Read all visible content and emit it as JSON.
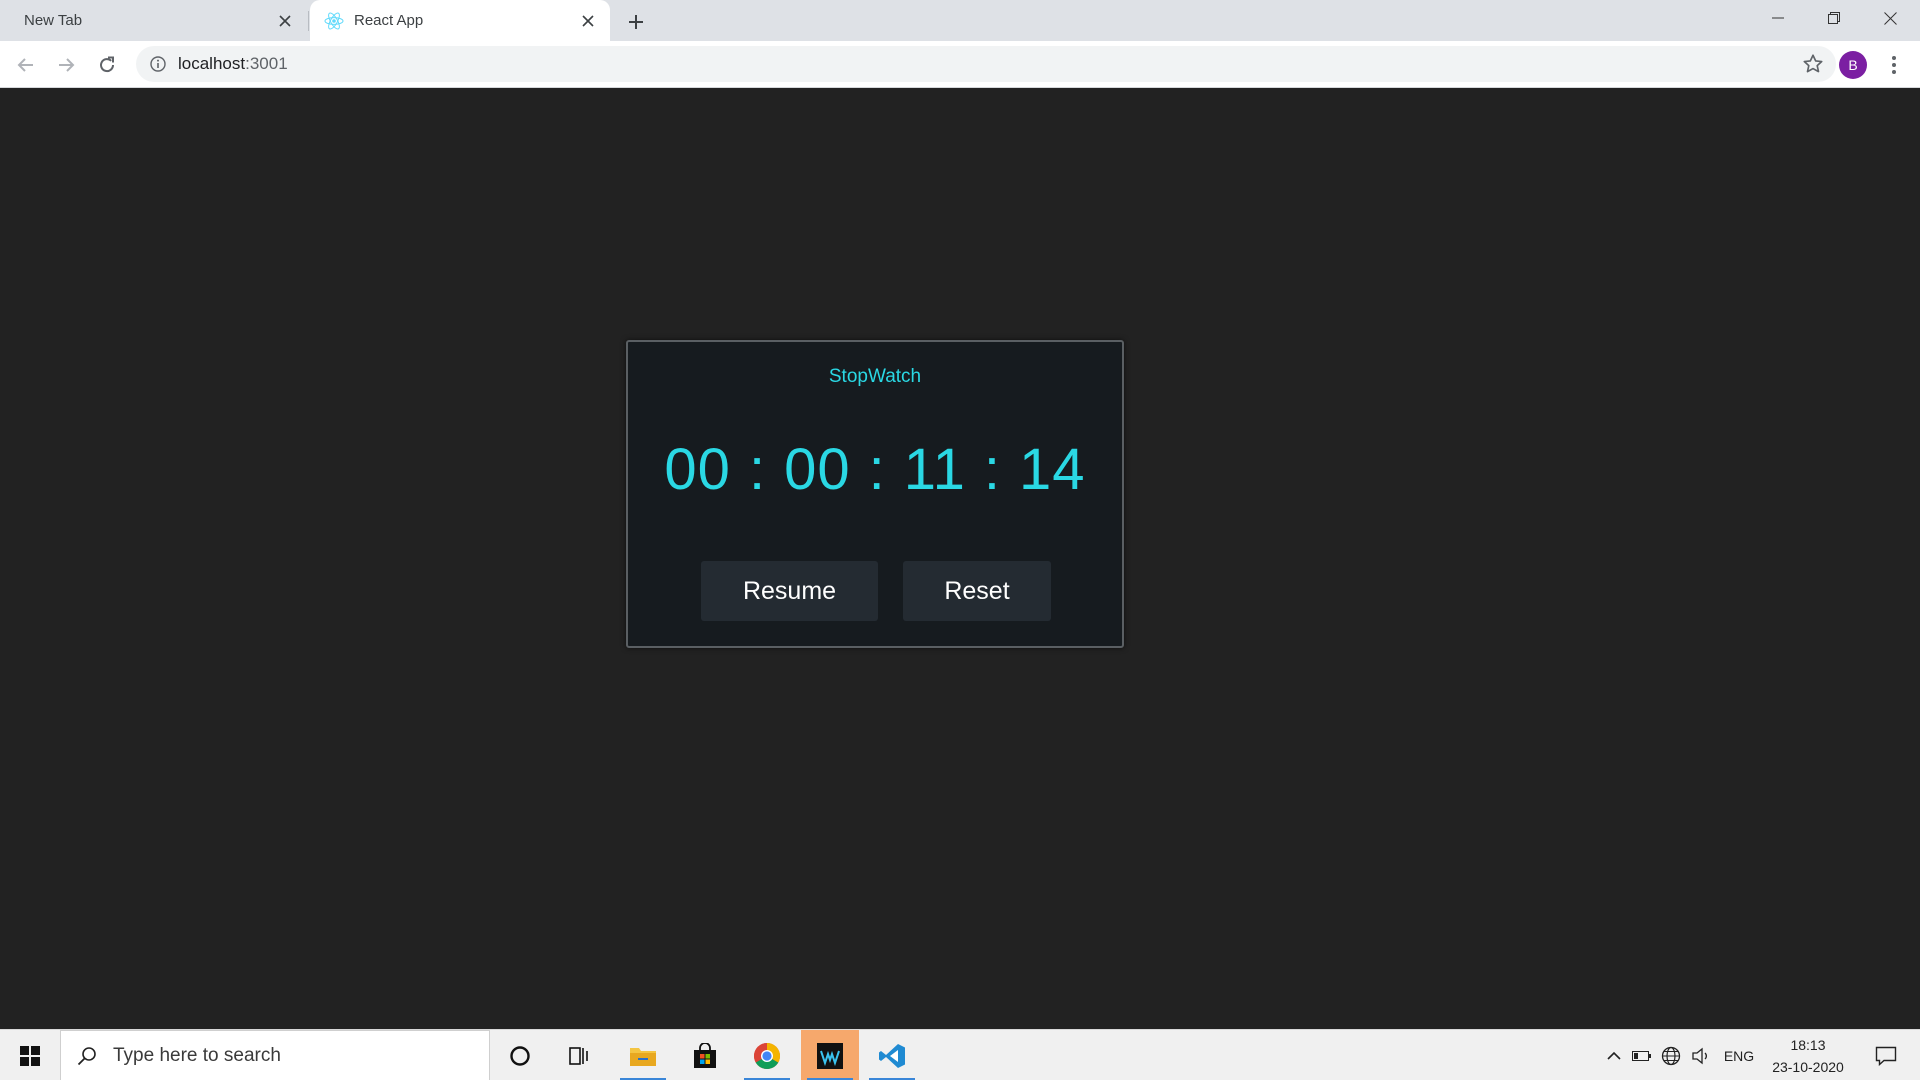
{
  "browser": {
    "tabs": [
      {
        "title": "New Tab",
        "active": false
      },
      {
        "title": "React App",
        "active": true
      }
    ],
    "url_host": "localhost",
    "url_port": ":3001",
    "profile_initial": "B"
  },
  "app": {
    "title": "StopWatch",
    "timer": {
      "hours": "00",
      "minutes": "00",
      "seconds": "11",
      "centiseconds": "14",
      "separator": ":"
    },
    "buttons": {
      "resume": "Resume",
      "reset": "Reset"
    },
    "colors": {
      "accent": "#2ad8e4",
      "card_bg": "#161b1f",
      "page_bg": "#222222",
      "button_bg": "#242b32"
    }
  },
  "taskbar": {
    "search_placeholder": "Type here to search",
    "language": "ENG",
    "time": "18:13",
    "date": "23-10-2020",
    "apps": [
      "cortana-icon",
      "task-view-icon",
      "file-explorer-icon",
      "store-icon",
      "chrome-icon",
      "audio-app-icon",
      "vscode-icon"
    ]
  }
}
